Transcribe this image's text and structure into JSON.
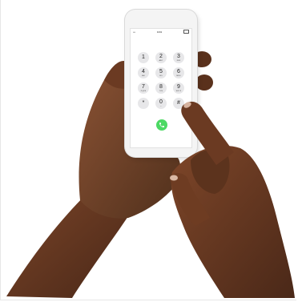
{
  "image": {
    "description_free": true,
    "colors": {
      "skin_dark": "#4a2818",
      "skin_mid": "#6b3a22",
      "skin_light": "#8a5234",
      "phone_body": "#f4f4f4",
      "call_green": "#4cd964",
      "key_gray": "#e7e7e9"
    }
  },
  "phone": {
    "status_time": "9:41",
    "keys": [
      {
        "digit": "1",
        "letters": ""
      },
      {
        "digit": "2",
        "letters": "ABC"
      },
      {
        "digit": "3",
        "letters": "DEF"
      },
      {
        "digit": "4",
        "letters": "GHI"
      },
      {
        "digit": "5",
        "letters": "JKL"
      },
      {
        "digit": "6",
        "letters": "MNO"
      },
      {
        "digit": "7",
        "letters": "PQRS"
      },
      {
        "digit": "8",
        "letters": "TUV"
      },
      {
        "digit": "9",
        "letters": "WXYZ"
      },
      {
        "digit": "*",
        "letters": ""
      },
      {
        "digit": "0",
        "letters": "+"
      },
      {
        "digit": "#",
        "letters": ""
      }
    ],
    "call_icon": "phone-call-icon"
  }
}
